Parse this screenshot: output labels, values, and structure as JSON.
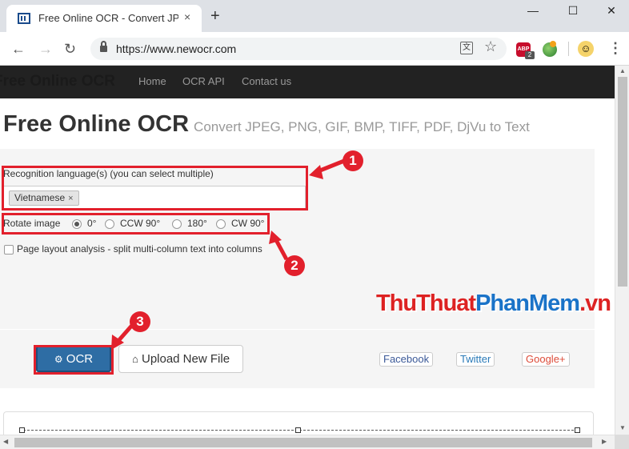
{
  "browser": {
    "tab_title": "Free Online OCR - Convert JPEG, PNG, GIF, BMP, TIFF",
    "tab_close": "×",
    "new_tab": "+",
    "win_min": "—",
    "win_max": "☐",
    "win_close": "✕",
    "url": "https://www.newocr.com",
    "ext_abp_label": "ABP",
    "ext_abp_badge": "2"
  },
  "navbar": {
    "brand": "Free Online OCR",
    "links": [
      "Home",
      "OCR API",
      "Contact us"
    ]
  },
  "heading": {
    "title": "Free Online OCR",
    "subtitle": "Convert JPEG, PNG, GIF, BMP, TIFF, PDF, DjVu to Text"
  },
  "form": {
    "language_label": "Recognition language(s) (you can select multiple)",
    "selected_language": "Vietnamese",
    "chip_remove": "×",
    "rotate_label": "Rotate image",
    "rotate_options": [
      "0°",
      "CCW 90°",
      "180°",
      "CW 90°"
    ],
    "rotate_selected": "0°",
    "layout_label": "Page layout analysis - split multi-column text into columns",
    "layout_checked": false
  },
  "actions": {
    "ocr_label": "OCR",
    "upload_label": "Upload New File",
    "social": [
      "Facebook",
      "Twitter",
      "Google+"
    ]
  },
  "annotations": {
    "step1": "1",
    "step2": "2",
    "step3": "3",
    "color": "#e2202c"
  },
  "watermark": {
    "part1": "ThuThuat",
    "part2": "PhanMem",
    "part3": ".vn"
  },
  "icons": {
    "back": "back-arrow-icon",
    "forward": "forward-arrow-icon",
    "reload": "reload-icon",
    "lock": "lock-icon",
    "translate": "translate-icon",
    "bookmark": "star-icon",
    "menu": "kebab-menu-icon",
    "ocr": "gear-icon",
    "upload": "home-icon"
  }
}
